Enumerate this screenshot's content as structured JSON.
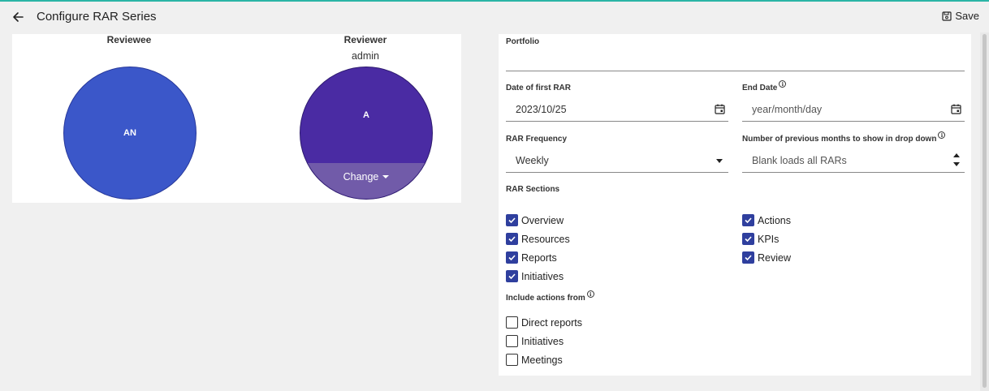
{
  "header": {
    "title": "Configure RAR Series",
    "save_label": "Save"
  },
  "colors": {
    "accent_top": "#2bb5a6",
    "reviewee_avatar": "#3b57c9",
    "reviewer_avatar": "#4a2ba3",
    "checkbox_checked": "#2f3f9e"
  },
  "reviewee": {
    "label": "Reviewee",
    "initials": "AN"
  },
  "reviewer": {
    "label": "Reviewer",
    "name": "admin",
    "initials": "A",
    "change_label": "Change"
  },
  "form": {
    "portfolio": {
      "label": "Portfolio",
      "value": ""
    },
    "date_first": {
      "label": "Date of first RAR",
      "value": "2023/10/25"
    },
    "end_date": {
      "label": "End Date",
      "placeholder": "year/month/day"
    },
    "frequency": {
      "label": "RAR Frequency",
      "value": "Weekly"
    },
    "prev_months": {
      "label": "Number of previous months to show in drop down",
      "placeholder": "Blank loads all RARs"
    },
    "sections_label": "RAR Sections",
    "sections": [
      {
        "label": "Overview",
        "checked": true
      },
      {
        "label": "Resources",
        "checked": true
      },
      {
        "label": "Reports",
        "checked": true
      },
      {
        "label": "Initiatives",
        "checked": true
      },
      {
        "label": "Actions",
        "checked": true
      },
      {
        "label": "KPIs",
        "checked": true
      },
      {
        "label": "Review",
        "checked": true
      }
    ],
    "include_label": "Include actions from",
    "include": [
      {
        "label": "Direct reports",
        "checked": false
      },
      {
        "label": "Initiatives",
        "checked": false
      },
      {
        "label": "Meetings",
        "checked": false
      }
    ]
  }
}
